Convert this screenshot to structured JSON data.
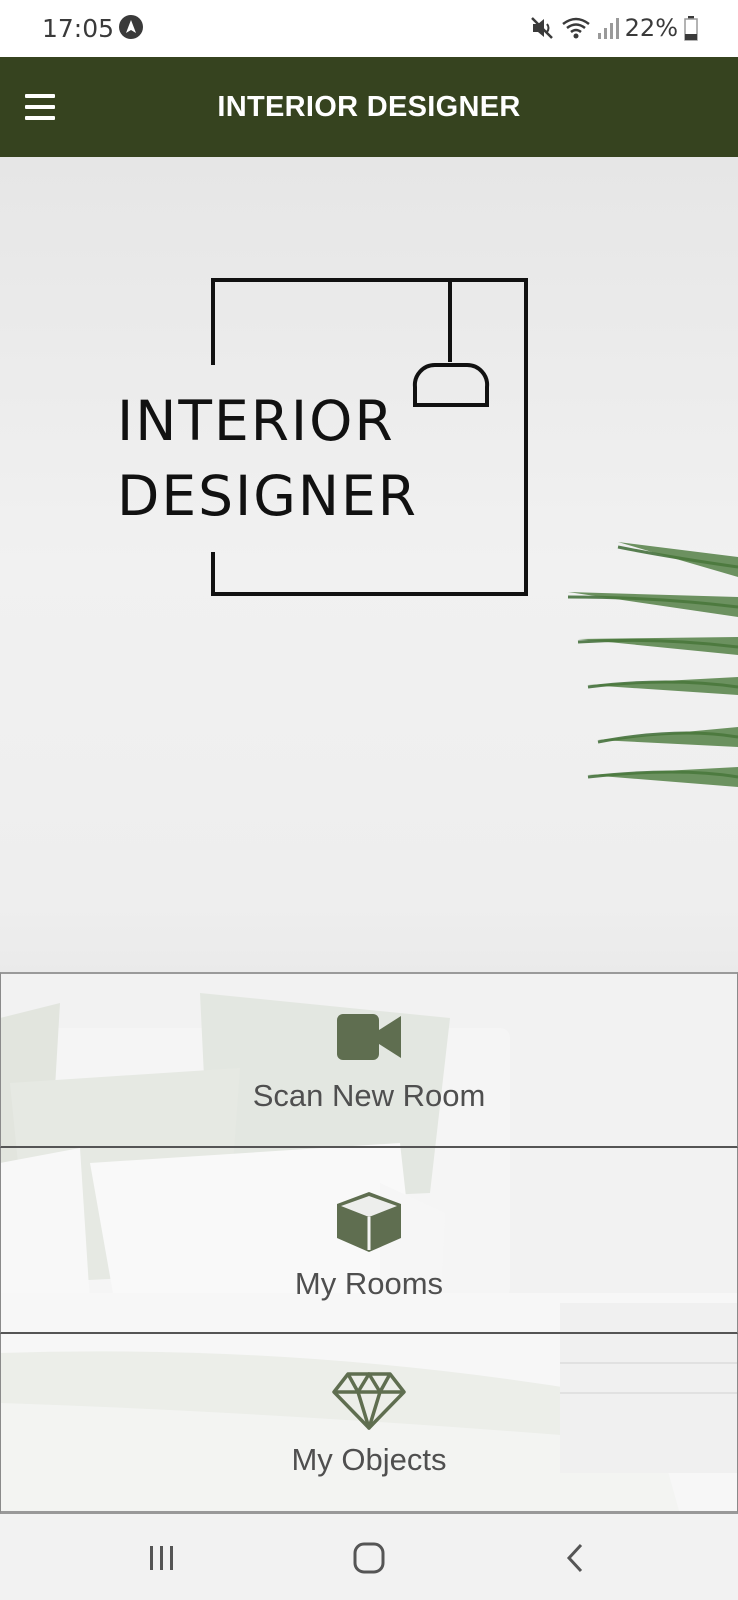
{
  "status_bar": {
    "time": "17:05",
    "app_icon": "navigation-arrow-icon",
    "icons": [
      "mute-icon",
      "wifi-icon",
      "signal-icon",
      "battery-icon"
    ],
    "battery": "22%"
  },
  "app_bar": {
    "title": "INTERIOR DESIGNER",
    "menu_icon": "hamburger-menu-icon",
    "background": "#36431f"
  },
  "logo": {
    "line1": "INTERIOR",
    "line2": "DESIGNER"
  },
  "menu": {
    "items": [
      {
        "label": "Scan New Room",
        "icon": "video-camera-icon"
      },
      {
        "label": "My Rooms",
        "icon": "cube-icon"
      },
      {
        "label": "My Objects",
        "icon": "diamond-icon"
      }
    ],
    "icon_color": "#5f6e50"
  },
  "nav_bar": {
    "buttons": [
      "recent-apps-icon",
      "home-icon",
      "back-icon"
    ]
  }
}
